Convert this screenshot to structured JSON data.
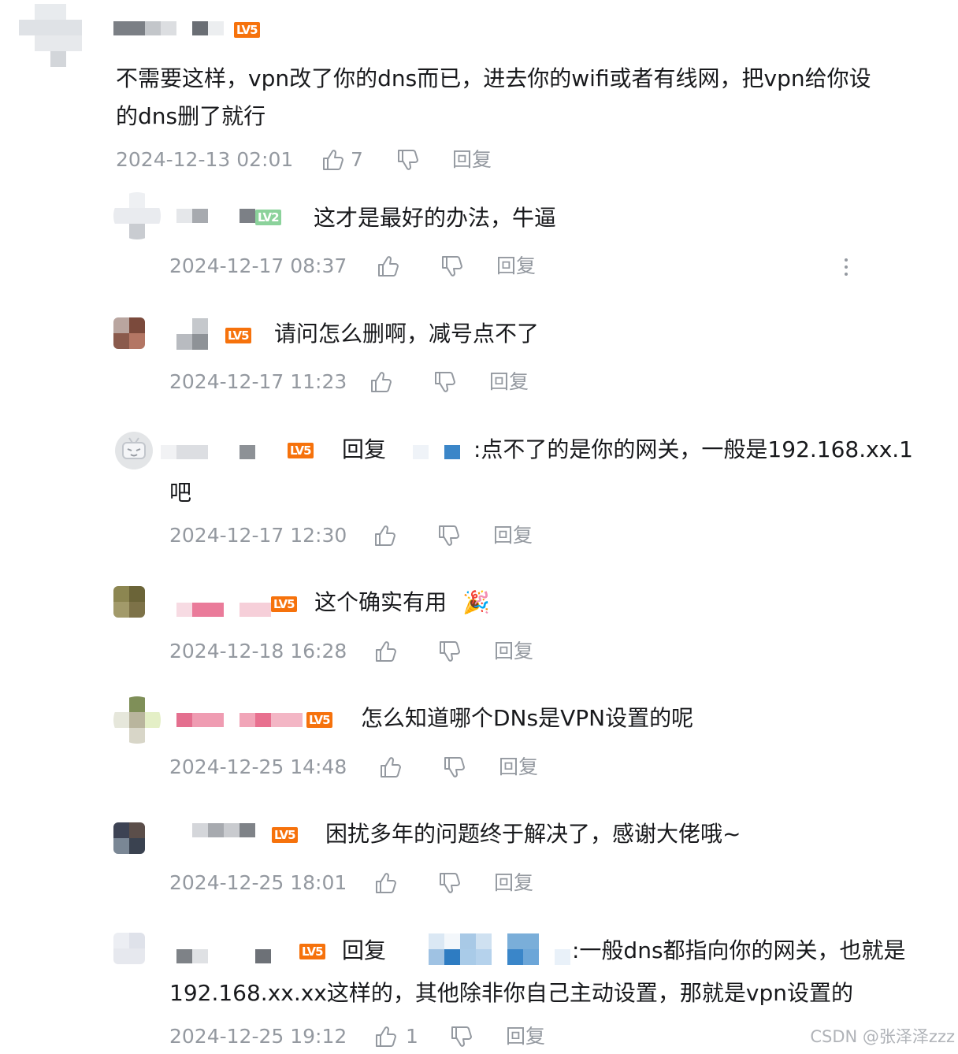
{
  "labels": {
    "reply": "回复",
    "reply_to": "回复"
  },
  "comments": [
    {
      "level": "LV5",
      "text1": "不需要这样，vpn改了你的dns而已，进去你的wifi或者有线网，把vpn给你设",
      "text2": "的dns删了就行",
      "time": "2024-12-13 02:01",
      "likes": "7"
    },
    {
      "level": "LV2",
      "text1": "这才是最好的办法，牛逼",
      "time": "2024-12-17 08:37"
    },
    {
      "level": "LV5",
      "text1": "请问怎么删啊，减号点不了",
      "time": "2024-12-17 11:23"
    },
    {
      "level": "LV5",
      "text1": ":点不了的是你的网关，一般是192.168.xx.1",
      "text2": "吧",
      "time": "2024-12-17 12:30"
    },
    {
      "level": "LV5",
      "text1": "这个确实有用",
      "emoji": "🎉",
      "time": "2024-12-18 16:28"
    },
    {
      "level": "LV5",
      "text1": "怎么知道哪个DNs是VPN设置的呢",
      "time": "2024-12-25 14:48"
    },
    {
      "level": "LV5",
      "text1": "困扰多年的问题终于解决了，感谢大佬哦~",
      "time": "2024-12-25 18:01"
    },
    {
      "level": "LV5",
      "text1": ":一般dns都指向你的网关，也就是",
      "text2": "192.168.xx.xx这样的，其他除非你自己主动设置，那就是vpn设置的",
      "time": "2024-12-25 19:12",
      "likes": "1"
    }
  ],
  "icons": {
    "like": "thumb-up-icon",
    "dislike": "thumb-down-icon",
    "more": "more-vertical-icon",
    "avatar_default": "tv-mascot-icon"
  },
  "colors": {
    "level_orange": "#f6720c",
    "level_green": "#8bd29b",
    "meta_gray": "#9499a0",
    "text": "#18191c"
  },
  "watermark": "CSDN @张泽泽zzz"
}
